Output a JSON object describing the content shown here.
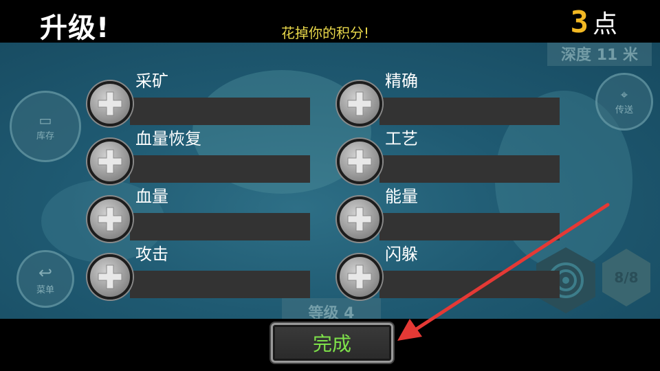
{
  "header": {
    "title": "升级!",
    "subtitle": "花掉你的积分!",
    "points_value": "3",
    "points_unit": "点"
  },
  "upgrades": {
    "left": [
      {
        "label": "采矿"
      },
      {
        "label": "血量恢复"
      },
      {
        "label": "血量"
      },
      {
        "label": "攻击"
      }
    ],
    "right": [
      {
        "label": "精确"
      },
      {
        "label": "工艺"
      },
      {
        "label": "能量"
      },
      {
        "label": "闪躲"
      }
    ]
  },
  "background": {
    "depth_label": "深度 11 米",
    "inventory_label": "库存",
    "teleport_label": "传送",
    "menu_label": "菜单",
    "level_label": "等级 4",
    "ammo_label": "8/8"
  },
  "footer": {
    "done_label": "完成"
  },
  "colors": {
    "title": "#ffffff",
    "subtitle": "#e9d84a",
    "points": "#f2b823",
    "done_text": "#7ee24a",
    "arrow": "#e53935"
  }
}
